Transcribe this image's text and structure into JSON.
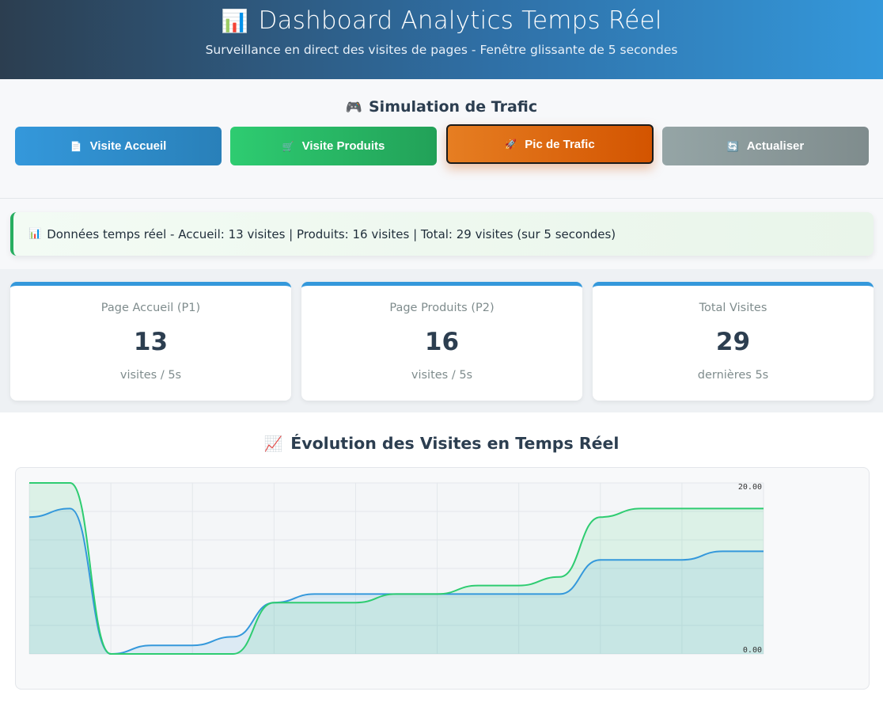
{
  "header": {
    "icon": "📊",
    "title": "Dashboard Analytics Temps Réel",
    "subtitle": "Surveillance en direct des visites de pages - Fenêtre glissante de 5 secondes"
  },
  "controls": {
    "icon": "🎮",
    "title": "Simulation de Trafic",
    "buttons": [
      {
        "icon": "📄",
        "label": "Visite Accueil"
      },
      {
        "icon": "🛒",
        "label": "Visite Produits"
      },
      {
        "icon": "🚀",
        "label": "Pic de Trafic"
      },
      {
        "icon": "🔄",
        "label": "Actualiser"
      }
    ]
  },
  "status": {
    "icon": "📊",
    "text": "Données temps réel - Accueil: 13 visites | Produits: 16 visites | Total: 29 visites (sur 5 secondes)"
  },
  "stats": [
    {
      "label": "Page Accueil (P1)",
      "value": "13",
      "sub": "visites / 5s"
    },
    {
      "label": "Page Produits (P2)",
      "value": "16",
      "sub": "visites / 5s"
    },
    {
      "label": "Total Visites",
      "value": "29",
      "sub": "dernières 5s"
    }
  ],
  "chart_section": {
    "icon": "📈",
    "title": "Évolution des Visites en Temps Réel"
  },
  "colors": {
    "accueil": "#3498db",
    "produits": "#2ecc71"
  },
  "chart_data": {
    "type": "area",
    "y_tick_labels": [
      "20.00",
      "0.00"
    ],
    "ylim": [
      0,
      20
    ],
    "grid": true,
    "legend": "none",
    "series": [
      {
        "values": [
          16,
          17,
          0,
          1,
          1,
          2,
          6,
          7,
          7,
          7,
          7,
          7,
          7,
          7,
          11,
          11,
          11,
          12,
          12
        ]
      },
      {
        "values": [
          20,
          20,
          0,
          0,
          0,
          0,
          6,
          6,
          6,
          7,
          7,
          8,
          8,
          9,
          16,
          17,
          17,
          17,
          17
        ]
      }
    ]
  }
}
